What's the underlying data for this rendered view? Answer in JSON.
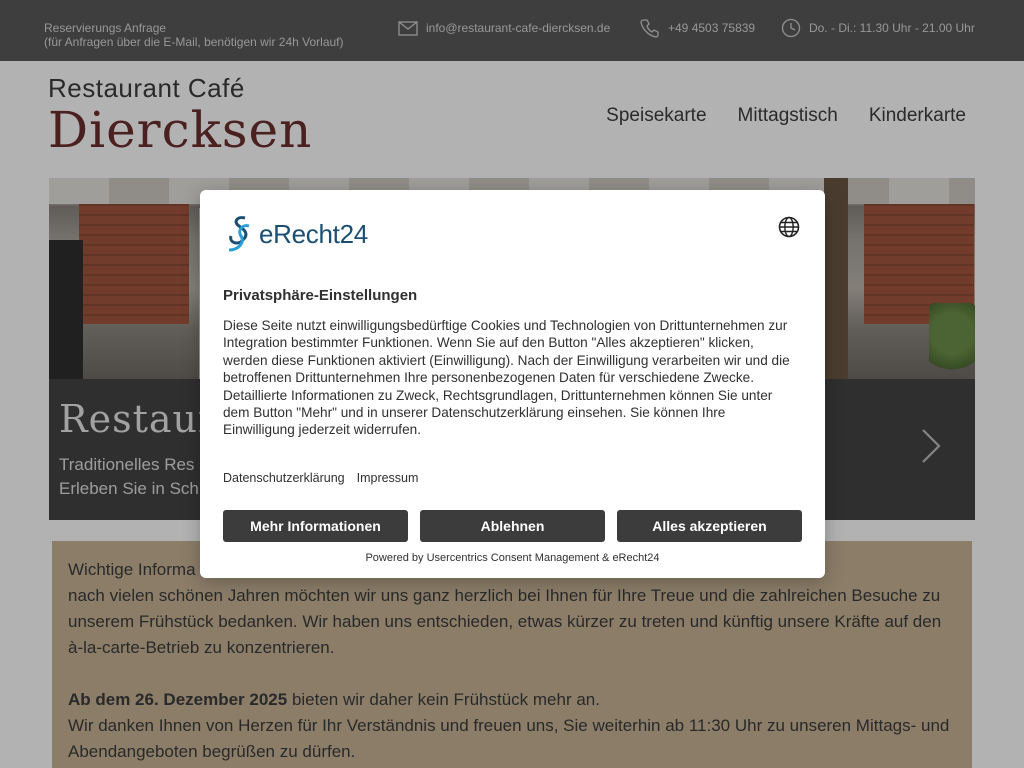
{
  "topbar": {
    "reservation_title": "Reservierungs Anfrage",
    "reservation_note": "(für Anfragen über die E-Mail, benötigen wir 24h Vorlauf)",
    "email": "info@restaurant-cafe-diercksen.de",
    "phone": "+49 4503 75839",
    "hours": "Do. - Di.: 11.30 Uhr - 21.00 Uhr"
  },
  "header": {
    "logo_top": "Restaurant Café",
    "logo_main": "Diercksen",
    "nav": [
      "Speisekarte",
      "Mittagstisch",
      "Kinderkarte"
    ]
  },
  "hero": {
    "title": "Restaurant",
    "line1": "Traditionelles Res",
    "line2": "Erleben Sie in Sch"
  },
  "info": {
    "line1": "Wichtige Informa",
    "para1": "nach vielen schönen Jahren möchten wir uns ganz herzlich bei Ihnen für Ihre Treue und die zahlreichen Besuche zu unserem Frühstück bedanken. Wir haben uns entschieden, etwas kürzer zu treten und künftig unsere Kräfte auf den à-la-carte-Betrieb zu konzentrieren.",
    "date_bold": "Ab dem 26. Dezember 2025",
    "date_rest": " bieten wir daher kein Frühstück mehr an.",
    "para2": "Wir danken Ihnen von Herzen für Ihr Verständnis und freuen uns, Sie weiterhin ab 11:30 Uhr zu unseren Mittags- und Abendangeboten begrüßen zu dürfen."
  },
  "consent": {
    "brand": "eRecht24",
    "title": "Privatsphäre-Einstellungen",
    "body": "Diese Seite nutzt einwilligungsbedürftige Cookies und Technologien von Drittunternehmen zur Integration bestimmter Funktionen. Wenn Sie auf den Button \"Alles akzeptieren\" klicken, werden diese Funktionen aktiviert (Einwilligung). Nach der Einwilligung verarbeiten wir und die betroffenen Drittunternehmen Ihre personenbezogenen Daten für verschiedene Zwecke. Detaillierte Informationen zu Zweck, Rechtsgrundlagen, Drittunternehmen können Sie unter dem Button \"Mehr\" und in unserer Datenschutzerklärung einsehen. Sie können Ihre Einwilligung jederzeit widerrufen.",
    "link_privacy": "Datenschutzerklärung",
    "link_imprint": "Impressum",
    "btn_more": "Mehr Informationen",
    "btn_decline": "Ablehnen",
    "btn_accept": "Alles akzeptieren",
    "powered": "Powered by Usercentrics Consent Management & eRecht24"
  },
  "colors": {
    "topbar": "#5a5a5a",
    "logo_accent": "#6b2f2f",
    "info_box": "#c8b496",
    "button": "#3c3c3c",
    "brand_blue": "#1b4e73"
  }
}
